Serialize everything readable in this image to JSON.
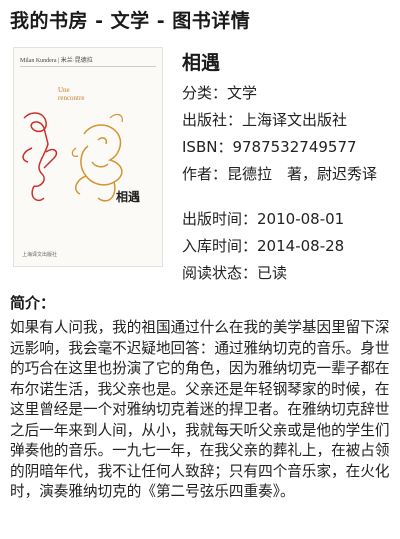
{
  "header": {
    "title": "我的书房 - 文学 - 图书详情"
  },
  "cover": {
    "author_line": "Milan Kundera | 米兰·昆德拉",
    "en_title": [
      "Une",
      "rencontre"
    ],
    "cn_title": "相遇",
    "publisher": "上海译文出版社",
    "accent_color": "#c57e2c"
  },
  "book": {
    "title": "相遇",
    "category_label": "分类：",
    "category": "文学",
    "publisher_label": "出版社：",
    "publisher": "上海译文出版社",
    "isbn_label": "ISBN：",
    "isbn": "9787532749577",
    "author_label": "作者：",
    "author": "昆德拉　著，尉迟秀译",
    "pub_date_label": "出版时间：",
    "pub_date": "2010-08-01",
    "stock_date_label": "入库时间：",
    "stock_date": "2014-08-28",
    "read_status_label": "阅读状态：",
    "read_status": "已读"
  },
  "intro": {
    "label": "简介：",
    "text": "如果有人问我，我的祖国通过什么在我的美学基因里留下深远影响，我会毫不迟疑地回答：通过雅纳切克的音乐。身世的巧合在这里也扮演了它的角色，因为雅纳切克一辈子都在布尔诺生活，我父亲也是。父亲还是年轻钢琴家的时候，在这里曾经是一个对雅纳切克着迷的捍卫者。在雅纳切克辞世之后一年来到人间，从小，我就每天听父亲或是他的学生们弹奏他的音乐。一九七一年，在我父亲的葬礼上，在被占领的阴暗年代，我不让任何人致辞；只有四个音乐家，在火化时，演奏雅纳切克的《第二号弦乐四重奏》。"
  }
}
